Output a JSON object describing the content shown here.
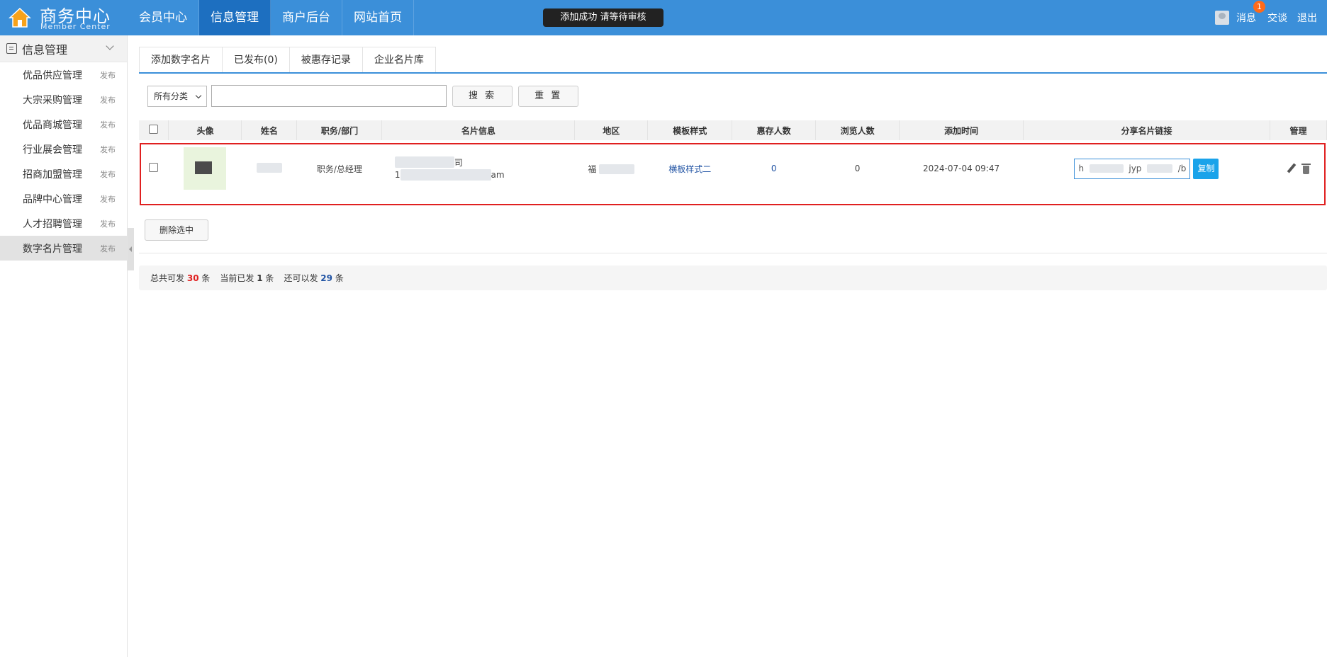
{
  "header": {
    "logo_title": "商务中心",
    "logo_subtitle": "Member Center",
    "nav": [
      {
        "label": "会员中心",
        "active": false
      },
      {
        "label": "信息管理",
        "active": true
      },
      {
        "label": "商户后台",
        "active": false
      },
      {
        "label": "网站首页",
        "active": false
      }
    ],
    "toast": "添加成功 请等待审核",
    "message_label": "消息",
    "message_count": "1",
    "chat_label": "交谈",
    "logout_label": "退出"
  },
  "sidebar": {
    "title": "信息管理",
    "items": [
      {
        "label": "优品供应管理",
        "action": "发布"
      },
      {
        "label": "大宗采购管理",
        "action": "发布"
      },
      {
        "label": "优品商城管理",
        "action": "发布"
      },
      {
        "label": "行业展会管理",
        "action": "发布"
      },
      {
        "label": "招商加盟管理",
        "action": "发布"
      },
      {
        "label": "品牌中心管理",
        "action": "发布"
      },
      {
        "label": "人才招聘管理",
        "action": "发布"
      },
      {
        "label": "数字名片管理",
        "action": "发布",
        "active": true
      }
    ]
  },
  "tabs": [
    "添加数字名片",
    "已发布(0)",
    "被惠存记录",
    "企业名片库"
  ],
  "filter": {
    "category_selected": "所有分类",
    "keyword_value": "",
    "search_label": "搜 索",
    "reset_label": "重 置"
  },
  "table": {
    "headers": [
      "头像",
      "姓名",
      "职务/部门",
      "名片信息",
      "地区",
      "模板样式",
      "惠存人数",
      "浏览人数",
      "添加时间",
      "分享名片链接",
      "管理"
    ],
    "rows": [
      {
        "title": "职务/总经理",
        "info_line1_tail": "司",
        "info_line2_head": "1",
        "info_line2_tail": "am",
        "region_head": "福",
        "template": "横板样式二",
        "saved_count": "0",
        "view_count": "0",
        "added_time": "2024-07-04 09:47",
        "share_link_head": "h",
        "share_link_mid": "jyp",
        "share_link_tail": "/b",
        "copy_label": "复制"
      }
    ]
  },
  "delete_selected_label": "删除选中",
  "summary": {
    "total_label": "总共可发",
    "total_value": "30",
    "current_label": "当前已发",
    "current_value": "1",
    "remaining_label": "还可以发",
    "remaining_value": "29",
    "unit": "条"
  },
  "colors": {
    "header_bg": "#3b8fd9",
    "nav_active_bg": "#1d6fc0",
    "highlight_border": "#e02020",
    "copy_button_bg": "#1aa3ea"
  }
}
